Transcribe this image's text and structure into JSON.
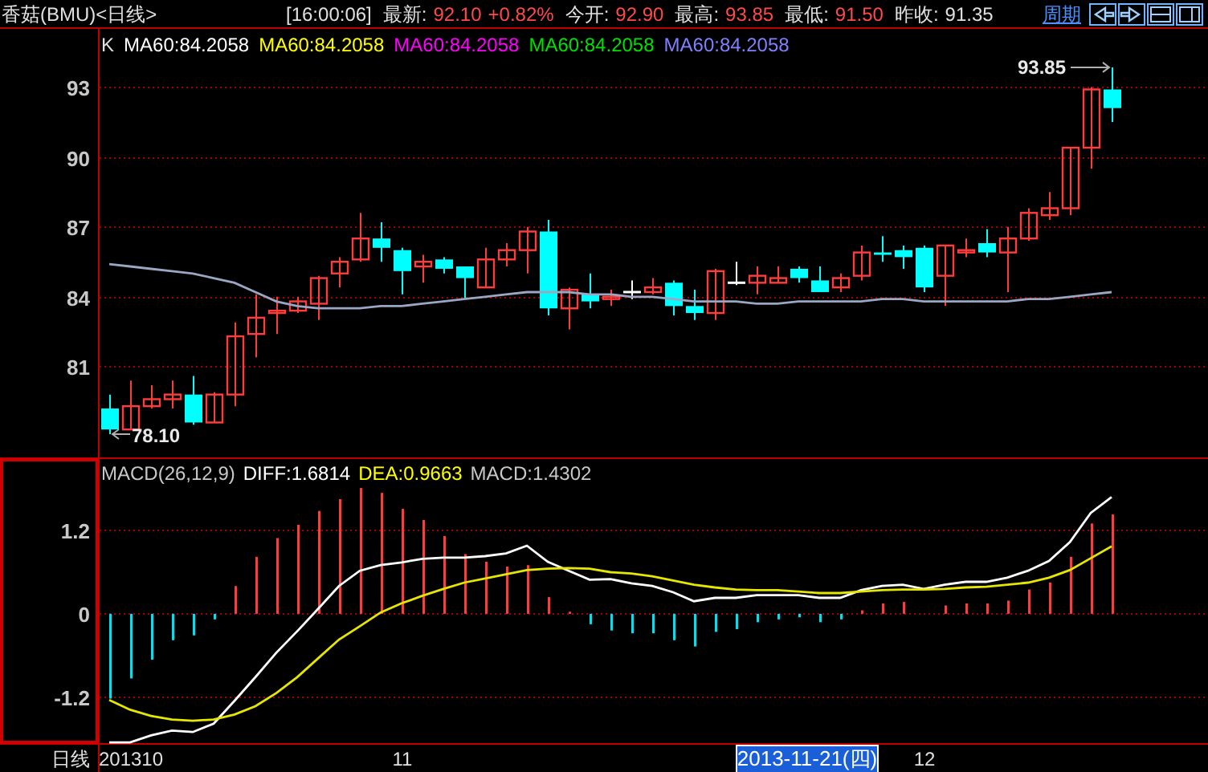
{
  "header": {
    "title": "香菇(BMU)<日线>",
    "time": "[16:00:06]",
    "quotes": [
      {
        "label": "最新:",
        "values": [
          "92.10",
          "+0.82%"
        ],
        "color": "#ff4a4a"
      },
      {
        "label": "今开:",
        "values": [
          "92.90"
        ],
        "color": "#ff4a4a"
      },
      {
        "label": "最高:",
        "values": [
          "93.85"
        ],
        "color": "#ff4a4a"
      },
      {
        "label": "最低:",
        "values": [
          "91.50"
        ],
        "color": "#ff4a4a"
      },
      {
        "label": "昨收:",
        "values": [
          "91.35"
        ],
        "color": "#e0e0e0"
      }
    ],
    "period_link": "周期"
  },
  "main_chart": {
    "legend": [
      {
        "text": "K",
        "color": "#e0e0e0"
      },
      {
        "text": "MA60:84.2058",
        "color": "#ffffff"
      },
      {
        "text": "MA60:84.2058",
        "color": "#ffff00"
      },
      {
        "text": "MA60:84.2058",
        "color": "#ff00ff"
      },
      {
        "text": "MA60:84.2058",
        "color": "#00e000"
      },
      {
        "text": "MA60:84.2058",
        "color": "#8080ff"
      }
    ],
    "chart_data": {
      "type": "candlestick",
      "grid": true,
      "ylim": [
        77.1,
        95.5
      ],
      "yticks": [
        81,
        84,
        87,
        90,
        93
      ],
      "ohlc": [
        [
          79.2,
          79.8,
          78.1,
          78.3
        ],
        [
          78.3,
          80.4,
          78.3,
          79.3
        ],
        [
          79.3,
          80.2,
          79.2,
          79.6
        ],
        [
          79.6,
          80.4,
          79.2,
          79.8
        ],
        [
          79.8,
          80.6,
          78.5,
          78.6
        ],
        [
          78.6,
          79.9,
          78.6,
          79.8
        ],
        [
          79.8,
          82.9,
          79.3,
          82.3
        ],
        [
          82.4,
          84.1,
          81.4,
          83.1
        ],
        [
          83.3,
          84.0,
          82.4,
          83.4
        ],
        [
          83.4,
          84.0,
          83.3,
          83.8
        ],
        [
          83.7,
          84.9,
          83.0,
          84.8
        ],
        [
          85.0,
          85.7,
          84.4,
          85.5
        ],
        [
          85.6,
          87.6,
          85.5,
          86.5
        ],
        [
          86.5,
          87.2,
          85.5,
          86.1
        ],
        [
          86.0,
          86.1,
          84.1,
          85.1
        ],
        [
          85.3,
          85.8,
          84.6,
          85.5
        ],
        [
          85.6,
          85.7,
          85.0,
          85.2
        ],
        [
          85.3,
          85.3,
          83.9,
          84.8
        ],
        [
          84.4,
          86.1,
          84.4,
          85.6
        ],
        [
          85.6,
          86.3,
          85.3,
          86.0
        ],
        [
          86.0,
          87.0,
          85.0,
          86.8
        ],
        [
          86.8,
          87.3,
          83.2,
          83.5
        ],
        [
          83.5,
          84.4,
          82.6,
          84.3
        ],
        [
          84.1,
          85.0,
          83.5,
          83.8
        ],
        [
          83.9,
          84.3,
          83.6,
          84.0
        ],
        [
          84.2,
          84.7,
          83.9,
          84.2
        ],
        [
          84.2,
          84.8,
          84.1,
          84.4
        ],
        [
          84.6,
          84.7,
          83.2,
          83.6
        ],
        [
          83.6,
          84.3,
          83.0,
          83.3
        ],
        [
          83.3,
          85.2,
          83.0,
          85.1
        ],
        [
          84.6,
          85.5,
          84.5,
          84.6
        ],
        [
          84.6,
          85.3,
          84.1,
          84.9
        ],
        [
          84.6,
          85.3,
          84.6,
          84.8
        ],
        [
          85.2,
          85.3,
          84.6,
          84.8
        ],
        [
          84.7,
          85.3,
          84.2,
          84.2
        ],
        [
          84.4,
          85.0,
          84.2,
          84.8
        ],
        [
          84.9,
          86.2,
          84.7,
          85.9
        ],
        [
          85.9,
          86.6,
          85.5,
          85.8
        ],
        [
          86.0,
          86.2,
          85.2,
          85.7
        ],
        [
          86.1,
          86.2,
          84.2,
          84.4
        ],
        [
          84.9,
          86.2,
          83.6,
          86.2
        ],
        [
          85.9,
          86.5,
          85.7,
          86.0
        ],
        [
          86.3,
          86.9,
          85.7,
          85.9
        ],
        [
          85.9,
          87.0,
          84.2,
          86.5
        ],
        [
          86.5,
          87.8,
          86.4,
          87.6
        ],
        [
          87.5,
          88.5,
          87.3,
          87.8
        ],
        [
          87.8,
          90.4,
          87.5,
          90.4
        ],
        [
          90.4,
          93.0,
          89.5,
          92.9
        ],
        [
          92.9,
          93.85,
          91.5,
          92.1
        ]
      ],
      "series": [
        {
          "type": "line",
          "color": "#9aa6c4",
          "values": [
            85.4,
            85.3,
            85.2,
            85.1,
            85.0,
            84.8,
            84.6,
            84.2,
            83.8,
            83.6,
            83.5,
            83.5,
            83.5,
            83.6,
            83.6,
            83.7,
            83.8,
            83.9,
            84.0,
            84.1,
            84.2,
            84.2,
            84.2,
            84.1,
            84.1,
            84.0,
            84.0,
            83.9,
            83.8,
            83.8,
            83.8,
            83.7,
            83.7,
            83.8,
            83.8,
            83.8,
            83.8,
            83.9,
            83.9,
            83.8,
            83.8,
            83.8,
            83.8,
            83.8,
            83.9,
            83.9,
            84.0,
            84.1,
            84.2
          ]
        }
      ],
      "annotations": [
        "93.85",
        "78.10"
      ]
    }
  },
  "macd_chart": {
    "legend": [
      {
        "text": "MACD(26,12,9)",
        "color": "#c8c8c8"
      },
      {
        "text": "DIFF:1.6814",
        "color": "#ffffff"
      },
      {
        "text": "DEA:0.9663",
        "color": "#ffff00"
      },
      {
        "text": "MACD:1.4302",
        "color": "#c8c8c8"
      }
    ],
    "chart_data": {
      "type": "bar",
      "grid": true,
      "xlabel": "日线",
      "ylim": [
        -1.86,
        2.25
      ],
      "yticks": [
        1.2,
        0,
        -1.2
      ],
      "categories": [
        null,
        "201310",
        null,
        null,
        null,
        null,
        null,
        null,
        null,
        null,
        null,
        null,
        null,
        null,
        "11",
        null,
        null,
        null,
        null,
        null,
        null,
        null,
        null,
        null,
        null,
        null,
        null,
        null,
        null,
        null,
        null,
        null,
        null,
        null,
        null,
        null,
        null,
        null,
        null,
        "12",
        null,
        null,
        null,
        null,
        null,
        null,
        null,
        null,
        null
      ],
      "series": [
        {
          "type": "bar",
          "colors": [
            "#00e0f0",
            "#00e0f0",
            "#00e0f0",
            "#00e0f0",
            "#00e0f0",
            "#00e0f0",
            "#ff3c3c",
            "#ff3c3c",
            "#ff3c3c",
            "#ff3c3c",
            "#ff3c3c",
            "#ff3c3c",
            "#ff3c3c",
            "#ff3c3c",
            "#ff3c3c",
            "#ff3c3c",
            "#ff3c3c",
            "#ff3c3c",
            "#ff3c3c",
            "#ff3c3c",
            "#ff3c3c",
            "#ff3c3c",
            "#ff3c3c",
            "#00e0f0",
            "#00e0f0",
            "#00e0f0",
            "#00e0f0",
            "#00e0f0",
            "#00e0f0",
            "#00e0f0",
            "#00e0f0",
            "#00e0f0",
            "#00e0f0",
            "#00e0f0",
            "#00e0f0",
            "#00e0f0",
            "#ff3c3c",
            "#ff3c3c",
            "#ff3c3c",
            null,
            "#ff3c3c",
            "#ff3c3c",
            "#ff3c3c",
            "#ff3c3c",
            "#ff3c3c",
            "#ff3c3c",
            "#ff3c3c",
            "#ff3c3c",
            "#ff3c3c"
          ],
          "values": [
            -1.22,
            -0.93,
            -0.66,
            -0.38,
            -0.31,
            -0.08,
            0.4,
            0.82,
            1.09,
            1.28,
            1.48,
            1.65,
            1.81,
            1.74,
            1.51,
            1.35,
            1.12,
            0.86,
            0.75,
            0.68,
            0.7,
            0.24,
            0.03,
            -0.15,
            -0.24,
            -0.28,
            -0.28,
            -0.38,
            -0.47,
            -0.26,
            -0.22,
            -0.12,
            -0.08,
            -0.05,
            -0.12,
            -0.08,
            0.05,
            0.15,
            0.17,
            0.0,
            0.12,
            0.15,
            0.15,
            0.19,
            0.35,
            0.45,
            0.82,
            1.3,
            1.43
          ]
        },
        {
          "type": "line",
          "color": "#ffffff",
          "values": [
            -1.85,
            -1.85,
            -1.75,
            -1.68,
            -1.7,
            -1.58,
            -1.25,
            -0.91,
            -0.56,
            -0.25,
            0.07,
            0.4,
            0.62,
            0.7,
            0.74,
            0.79,
            0.81,
            0.81,
            0.83,
            0.87,
            0.98,
            0.75,
            0.62,
            0.49,
            0.5,
            0.44,
            0.4,
            0.31,
            0.18,
            0.23,
            0.23,
            0.27,
            0.27,
            0.27,
            0.23,
            0.23,
            0.34,
            0.4,
            0.42,
            0.36,
            0.42,
            0.46,
            0.46,
            0.52,
            0.62,
            0.76,
            1.03,
            1.45,
            1.68
          ]
        },
        {
          "type": "line",
          "color": "#e6e600",
          "values": [
            -1.24,
            -1.38,
            -1.47,
            -1.52,
            -1.54,
            -1.52,
            -1.45,
            -1.33,
            -1.14,
            -0.91,
            -0.64,
            -0.37,
            -0.18,
            0.02,
            0.15,
            0.26,
            0.36,
            0.45,
            0.51,
            0.57,
            0.63,
            0.65,
            0.66,
            0.65,
            0.6,
            0.58,
            0.54,
            0.48,
            0.42,
            0.38,
            0.35,
            0.34,
            0.34,
            0.32,
            0.3,
            0.3,
            0.32,
            0.34,
            0.35,
            0.35,
            0.36,
            0.38,
            0.39,
            0.42,
            0.45,
            0.52,
            0.63,
            0.8,
            0.97
          ]
        }
      ]
    },
    "cursor_date": "2013-11-21(四)"
  }
}
